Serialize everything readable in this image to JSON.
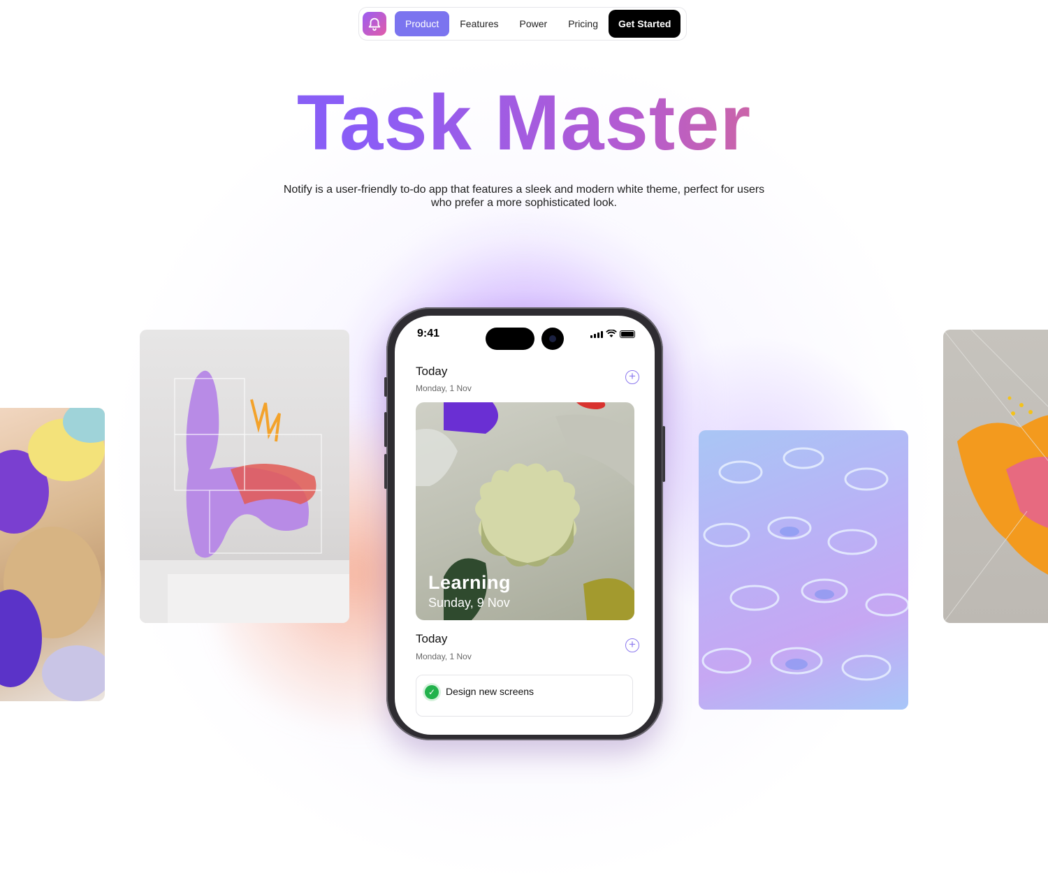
{
  "nav": {
    "logo_icon": "bell-chat-icon",
    "items": [
      "Product",
      "Features",
      "Power",
      "Pricing"
    ],
    "active": "Product",
    "cta_label": "Get Started"
  },
  "hero": {
    "title": "Task Master",
    "subtitle": "Notify is a user-friendly to-do app that features a sleek and modern white theme, perfect for users who prefer a more sophisticated look."
  },
  "phone": {
    "status_time": "9:41",
    "section1": {
      "title": "Today",
      "date": "Monday, 1 Nov"
    },
    "feature_card": {
      "title": "Learning",
      "date": "Sunday, 9 Nov"
    },
    "section2": {
      "title": "Today",
      "date": "Monday, 1 Nov"
    },
    "tasks": [
      {
        "label": "Design new screens",
        "done": true
      }
    ]
  },
  "colors": {
    "accent": "#7b74ef",
    "title_gradient_start": "#7c6cf2",
    "title_gradient_end": "#f27a45",
    "check": "#22b24c"
  }
}
